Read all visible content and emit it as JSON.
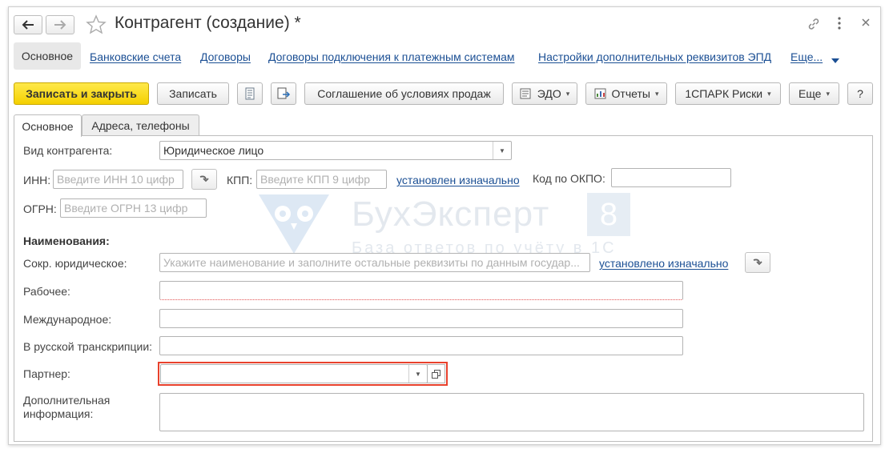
{
  "window": {
    "title": "Контрагент (создание) *"
  },
  "header_icons": {
    "link": "link-icon",
    "menu": "more-vertical-icon",
    "close": "close-icon",
    "star": "star-icon"
  },
  "sections": {
    "active": "Основное",
    "links": [
      "Банковские счета",
      "Договоры",
      "Договоры подключения к платежным системам",
      "Настройки дополнительных реквизитов ЭПД",
      "Еще..."
    ]
  },
  "toolbar": {
    "save_close": "Записать и закрыть",
    "save": "Записать",
    "agreement": "Соглашение об условиях продаж",
    "edo": "ЭДО",
    "reports": "Отчеты",
    "spark": "1СПАРК Риски",
    "more": "Еще",
    "help": "?"
  },
  "tabs": [
    "Основное",
    "Адреса, телефоны"
  ],
  "form": {
    "kind_label": "Вид контрагента:",
    "kind_value": "Юридическое лицо",
    "inn_label": "ИНН:",
    "inn_placeholder": "Введите ИНН 10 цифр",
    "kpp_label": "КПП:",
    "kpp_placeholder": "Введите КПП 9 цифр",
    "kpp_link": "установлен изначально",
    "okpo_label": "Код по ОКПО:",
    "ogrn_label": "ОГРН:",
    "ogrn_placeholder": "Введите ОГРН 13 цифр",
    "names_heading": "Наименования:",
    "short_label": "Сокр. юридическое:",
    "short_placeholder": "Укажите наименование и заполните остальные реквизиты по данным государ...",
    "short_link": "установлено изначально",
    "work_label": "Рабочее:",
    "intl_label": "Международное:",
    "rus_label": "В русской транскрипции:",
    "partner_label": "Партнер:",
    "extra_label_1": "Дополнительная",
    "extra_label_2": "информация:"
  },
  "watermark": {
    "brand": "БухЭксперт",
    "badge": "8",
    "tagline": "База ответов по учёту в 1С"
  },
  "colors": {
    "accent_yellow": "#f4d000",
    "link_blue": "#1b4f94",
    "highlight_red": "#e8412c",
    "required_red": "#e05050"
  }
}
